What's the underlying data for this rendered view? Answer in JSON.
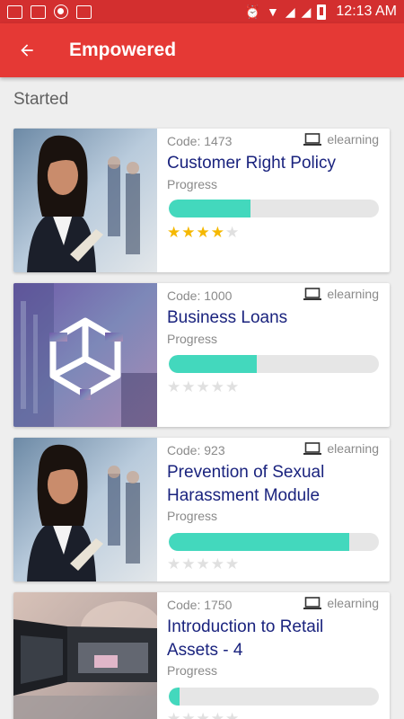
{
  "status_bar": {
    "time": "12:13 AM",
    "left_icons": [
      "grid-app-icon",
      "image-icon",
      "record-icon",
      "pulse-icon"
    ],
    "right_icons": [
      "alarm-icon",
      "wifi-icon",
      "signal-off-icon",
      "signal-icon",
      "battery-charging-icon"
    ]
  },
  "app_bar": {
    "title": "Empowered",
    "back_icon": "arrow-back-icon",
    "color": "#e53935"
  },
  "section": {
    "title": "Started"
  },
  "courses": [
    {
      "code": "Code: 1473",
      "type": "elearning",
      "title": "Customer Right Policy",
      "progress_label": "Progress",
      "progress": 0.39,
      "rating": 4,
      "image": "businesswoman-photo"
    },
    {
      "code": "Code: 1000",
      "type": "elearning",
      "title": "Business Loans",
      "progress_label": "Progress",
      "progress": 0.42,
      "rating": 0,
      "image": "unity-logo-image"
    },
    {
      "code": "Code: 923",
      "type": "elearning",
      "title": "Prevention of Sexual Harassment Module",
      "progress_label": "Progress",
      "progress": 0.86,
      "rating": 0,
      "image": "businesswoman-photo"
    },
    {
      "code": "Code: 1750",
      "type": "elearning",
      "title": "Introduction to Retail Assets - 4",
      "progress_label": "Progress",
      "progress": 0.05,
      "rating": 0,
      "image": "atm-card-photo"
    }
  ],
  "colors": {
    "status_bar": "#d32f2f",
    "accent_progress": "#43d8bd",
    "title_text": "#1a237e",
    "star_on": "#f5b800"
  }
}
